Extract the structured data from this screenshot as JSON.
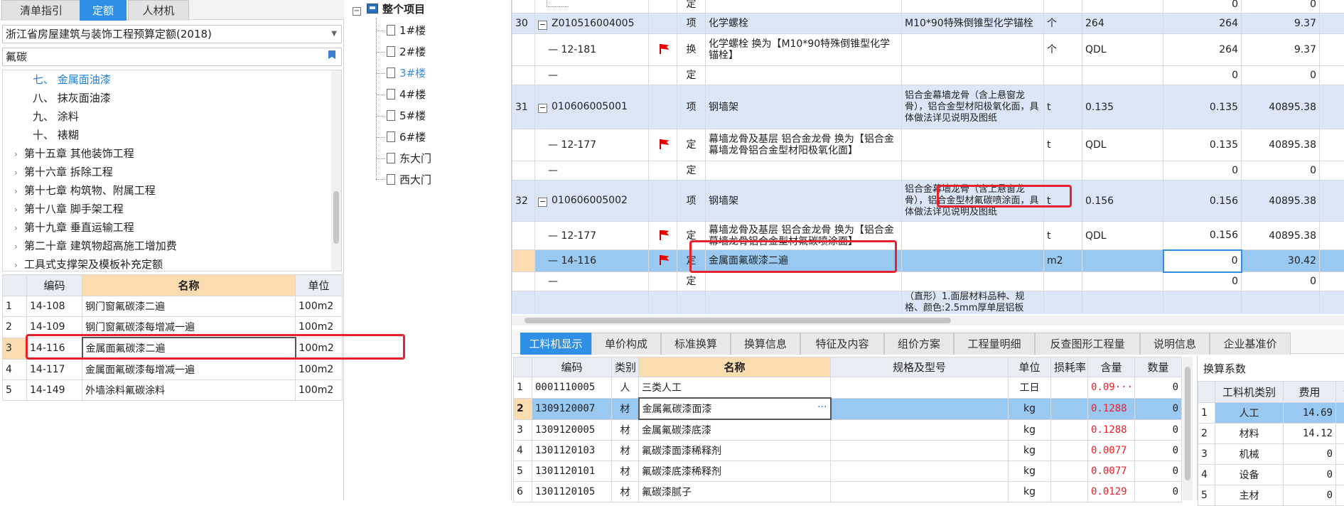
{
  "left": {
    "tabs": [
      {
        "label": "清单指引",
        "active": false
      },
      {
        "label": "定额",
        "active": true
      },
      {
        "label": "人材机",
        "active": false
      }
    ],
    "quota_library": "浙江省房屋建筑与装饰工程预算定额(2018)",
    "search_value": "氟碳",
    "tree": [
      {
        "label": "七、 金属面油漆",
        "selected": true
      },
      {
        "label": "八、 抹灰面油漆"
      },
      {
        "label": "九、 涂料"
      },
      {
        "label": "十、 裱糊"
      },
      {
        "label": "第十五章 其他装饰工程"
      },
      {
        "label": "第十六章 拆除工程"
      },
      {
        "label": "第十七章 构筑物、附属工程"
      },
      {
        "label": "第十八章 脚手架工程"
      },
      {
        "label": "第十九章 垂直运输工程"
      },
      {
        "label": "第二十章 建筑物超高施工增加费"
      },
      {
        "label": "工具式支撑架及模板补充定额"
      }
    ],
    "table": {
      "headers": [
        "编码",
        "名称",
        "单位"
      ],
      "rows": [
        {
          "idx": "1",
          "code": "14-108",
          "name": "钢门窗氟碳漆二遍",
          "unit": "100m2"
        },
        {
          "idx": "2",
          "code": "14-109",
          "name": "钢门窗氟碳漆每增减一遍",
          "unit": "100m2"
        },
        {
          "idx": "3",
          "code": "14-116",
          "name": "金属面氟碳漆二遍",
          "unit": "100m2"
        },
        {
          "idx": "4",
          "code": "14-117",
          "name": "金属面氟碳漆每增减一遍",
          "unit": "100m2"
        },
        {
          "idx": "5",
          "code": "14-149",
          "name": "外墙涂料氟碳涂料",
          "unit": "100m2"
        }
      ]
    }
  },
  "middle": {
    "root": "整个项目",
    "items": [
      "1#楼",
      "2#楼",
      "3#楼",
      "4#楼",
      "5#楼",
      "6#楼",
      "东大门",
      "西大门"
    ],
    "selected_index": 2
  },
  "main": {
    "rows": [
      {
        "no": "",
        "code": "",
        "type": "定",
        "name": "",
        "feature": "",
        "unit": "",
        "expr": "",
        "qty": "0",
        "price": "0"
      },
      {
        "no": "30",
        "code": "Z010516004005",
        "type": "项",
        "name": "化学螺栓",
        "feature": "M10*90特殊倒锥型化学锚栓",
        "unit": "个",
        "expr": "264",
        "qty": "264",
        "price": "9.37"
      },
      {
        "no": "",
        "code": "12-181",
        "type": "换",
        "name": "化学螺栓  换为【M10*90特殊倒锥型化学锚栓】",
        "feature": "",
        "unit": "个",
        "expr": "QDL",
        "qty": "264",
        "price": "9.37"
      },
      {
        "no": "",
        "code": "",
        "type": "定",
        "name": "",
        "feature": "",
        "unit": "",
        "expr": "",
        "qty": "0",
        "price": "0"
      },
      {
        "no": "31",
        "code": "010606005001",
        "type": "项",
        "name": "钢墙架",
        "feature": "铝合金幕墙龙骨（含上悬窗龙骨），铝合金型材阳极氧化面，具体做法详见说明及图纸",
        "unit": "t",
        "expr": "0.135",
        "qty": "0.135",
        "price": "40895.38"
      },
      {
        "no": "",
        "code": "12-177",
        "type": "定",
        "name": "幕墙龙骨及基层 铝合金龙骨  换为【铝合金幕墙龙骨铝合金型材阳极氧化面】",
        "feature": "",
        "unit": "t",
        "expr": "QDL",
        "qty": "0.135",
        "price": "40895.38"
      },
      {
        "no": "",
        "code": "",
        "type": "定",
        "name": "",
        "feature": "",
        "unit": "",
        "expr": "",
        "qty": "0",
        "price": "0"
      },
      {
        "no": "32",
        "code": "010606005002",
        "type": "项",
        "name": "钢墙架",
        "feature": "铝合金幕墙龙骨（含上悬窗龙骨），铝合金型材氟碳喷涂面，具体做法详见说明及图纸",
        "unit": "t",
        "expr": "0.156",
        "qty": "0.156",
        "price": "40895.38"
      },
      {
        "no": "",
        "code": "12-177",
        "type": "定",
        "name": "幕墙龙骨及基层 铝合金龙骨  换为【铝合金幕墙龙骨铝合金型材氟碳喷涂面】",
        "feature": "",
        "unit": "t",
        "expr": "QDL",
        "qty": "0.156",
        "price": "40895.38"
      },
      {
        "no": "",
        "code": "14-116",
        "type": "定",
        "name": "金属面氟碳漆二遍",
        "feature": "",
        "unit": "m2",
        "expr": "",
        "qty": "0",
        "price": "30.42"
      },
      {
        "no": "",
        "code": "",
        "type": "定",
        "name": "",
        "feature": "",
        "unit": "",
        "expr": "",
        "qty": "0",
        "price": "0"
      },
      {
        "no": "",
        "code": "",
        "type": "",
        "name": "",
        "feature": "（直形）1.面层材料品种、规格、颜色:2.5mm厚单层铝板",
        "unit": "",
        "expr": "",
        "qty": "",
        "price": ""
      }
    ]
  },
  "bottom": {
    "tabs": [
      "工料机显示",
      "单价构成",
      "标准换算",
      "换算信息",
      "特征及内容",
      "组价方案",
      "工程量明细",
      "反查图形工程量",
      "说明信息",
      "企业基准价"
    ],
    "headers": [
      "编码",
      "类别",
      "名称",
      "规格及型号",
      "单位",
      "损耗率",
      "含量",
      "数量"
    ],
    "rows": [
      {
        "idx": "1",
        "code": "0001110005",
        "cat": "人",
        "name": "三类人工",
        "spec": "",
        "unit": "工日",
        "loss": "",
        "content": "0.09···",
        "qty": "0"
      },
      {
        "idx": "2",
        "code": "1309120007",
        "cat": "材",
        "name": "金属氟碳漆面漆",
        "spec": "",
        "unit": "kg",
        "loss": "",
        "content": "0.1288",
        "qty": "0"
      },
      {
        "idx": "3",
        "code": "1309120005",
        "cat": "材",
        "name": "金属氟碳漆底漆",
        "spec": "",
        "unit": "kg",
        "loss": "",
        "content": "0.1288",
        "qty": "0"
      },
      {
        "idx": "4",
        "code": "1301120103",
        "cat": "材",
        "name": "氟碳漆面漆稀释剂",
        "spec": "",
        "unit": "kg",
        "loss": "",
        "content": "0.0077",
        "qty": "0"
      },
      {
        "idx": "5",
        "code": "1301120101",
        "cat": "材",
        "name": "氟碳漆底漆稀释剂",
        "spec": "",
        "unit": "kg",
        "loss": "",
        "content": "0.0077",
        "qty": "0"
      },
      {
        "idx": "6",
        "code": "1301120105",
        "cat": "材",
        "name": "氟碳漆腻子",
        "spec": "",
        "unit": "kg",
        "loss": "",
        "content": "0.0129",
        "qty": "0"
      }
    ],
    "selected_index": 1,
    "ellipsis": "···"
  },
  "conversion": {
    "title": "换算系数",
    "headers": [
      "工料机类别",
      "费用",
      "调"
    ],
    "rows": [
      {
        "idx": "1",
        "cat": "人工",
        "fee": "14.69"
      },
      {
        "idx": "2",
        "cat": "材料",
        "fee": "14.12"
      },
      {
        "idx": "3",
        "cat": "机械",
        "fee": "0"
      },
      {
        "idx": "4",
        "cat": "设备",
        "fee": "0"
      },
      {
        "idx": "5",
        "cat": "主材",
        "fee": "0"
      }
    ]
  },
  "colors": {
    "accent": "#2f8fe6",
    "highlight": "#e8222c",
    "selected_row": "#99c9f0",
    "item_row": "#dbe7f8"
  }
}
